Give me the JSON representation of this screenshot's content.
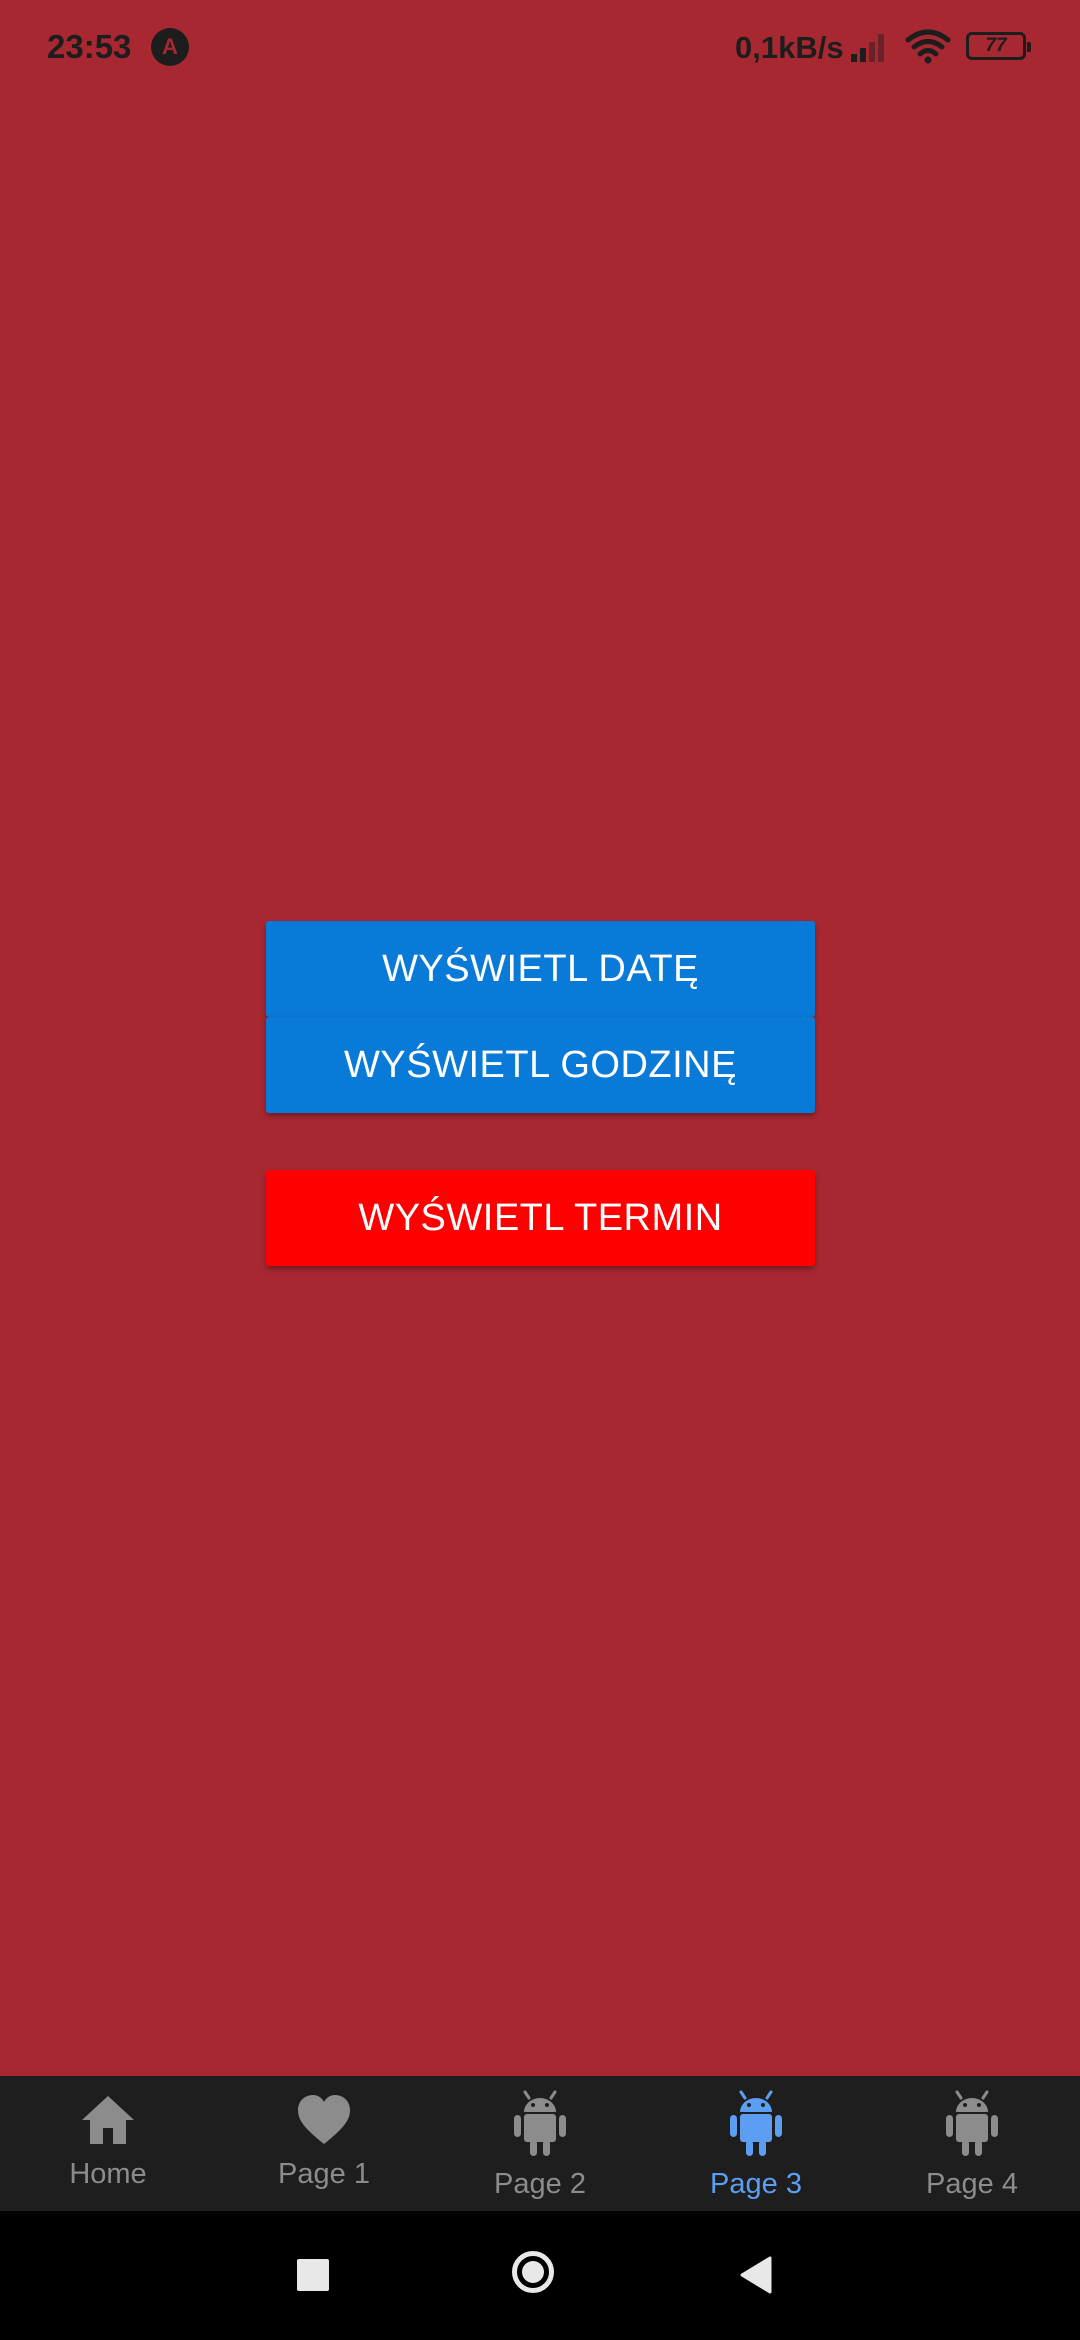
{
  "status_bar": {
    "time": "23:53",
    "app_icon": "A",
    "network_speed": "0,1kB/s",
    "battery": "77"
  },
  "buttons": {
    "show_date": "WYŚWIETL DATĘ",
    "show_hour": "WYŚWIETL GODZINĘ",
    "show_term": "WYŚWIETL TERMIN"
  },
  "tabs": [
    {
      "label": "Home",
      "icon": "home-icon",
      "active": false
    },
    {
      "label": "Page 1",
      "icon": "heart-icon",
      "active": false
    },
    {
      "label": "Page 2",
      "icon": "android-icon",
      "active": false
    },
    {
      "label": "Page 3",
      "icon": "android-icon",
      "active": true
    },
    {
      "label": "Page 4",
      "icon": "android-icon",
      "active": false
    }
  ],
  "colors": {
    "background": "#a82832",
    "primary_button": "#0a7ad9",
    "danger_button": "#ff0000",
    "tab_active": "#5b9ef2",
    "tab_inactive": "#8c8c8c"
  }
}
